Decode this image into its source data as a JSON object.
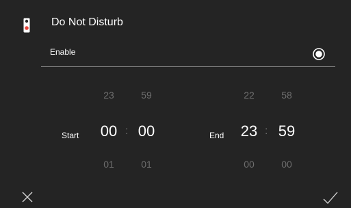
{
  "dialog": {
    "title": "Do Not Disturb",
    "enable": {
      "label": "Enable",
      "checked": true
    },
    "start": {
      "label": "Start",
      "hour": {
        "prev": "23",
        "value": "00",
        "next": "01"
      },
      "minute": {
        "prev": "59",
        "value": "00",
        "next": "01"
      },
      "separator": ":"
    },
    "end": {
      "label": "End",
      "hour": {
        "prev": "22",
        "value": "23",
        "next": "00"
      },
      "minute": {
        "prev": "58",
        "value": "59",
        "next": "00"
      },
      "separator": ":"
    },
    "icons": {
      "title_icon": "door-hanger-icon",
      "cancel": "close-icon",
      "confirm": "checkmark-icon"
    },
    "colors": {
      "background": "#242424",
      "accent": "#e8453c",
      "dim_text": "#6e6e6e"
    }
  }
}
